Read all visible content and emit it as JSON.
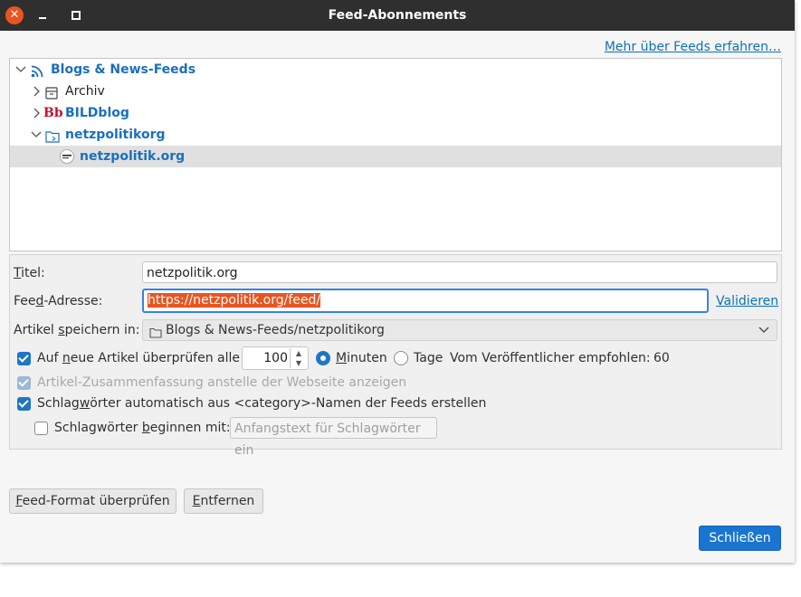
{
  "window": {
    "title": "Feed-Abonnements",
    "close_glyph": "✕"
  },
  "learn_more": "Mehr über Feeds erfahren…",
  "tree": {
    "items": [
      {
        "label": "Blogs & News-Feeds",
        "icon": "rss-icon",
        "toggle": "⌵"
      },
      {
        "label": "Archiv",
        "icon": "archive-icon",
        "toggle": "›"
      },
      {
        "label": "BILDblog",
        "icon": "bildblog-icon",
        "toggle": "›",
        "icon_text": "Bb"
      },
      {
        "label": "netzpolitikorg",
        "icon": "folder-rss-icon",
        "toggle": "⌵"
      },
      {
        "label": "netzpolitik.org",
        "icon": "favicon-icon"
      }
    ]
  },
  "form": {
    "title_label": "Titel:",
    "title_label_u": "T",
    "title_label_rest": "itel:",
    "title_value": "netzpolitik.org",
    "url_label_a": "Fee",
    "url_label_u": "d",
    "url_label_b": "-Adresse:",
    "url_value": "https://netzpolitik.org/feed/",
    "validate": "Validieren",
    "store_label_a": "Artikel ",
    "store_label_u": "s",
    "store_label_b": "peichern in:",
    "store_value": "Blogs & News-Feeds/netzpolitikorg",
    "check_label_a": "Auf ",
    "check_label_u": "n",
    "check_label_b": "eue Artikel überprüfen alle",
    "interval": "100",
    "minutes_u": "M",
    "minutes_rest": "inuten",
    "days": "Tage",
    "publisher": "Vom Veröffentlicher empfohlen:",
    "publisher_value": "60",
    "summary_label": "Artikel-Zusammenfassung anstelle der Webseite anzeigen",
    "tags_a": "Schlag",
    "tags_u": "w",
    "tags_b": "örter automatisch aus <category>-Namen der Feeds erstellen",
    "prefix_a": "Schlagwörter ",
    "prefix_u": "b",
    "prefix_b": "eginnen mit:",
    "prefix_placeholder": "Anfangstext für Schlagwörter ein"
  },
  "buttons": {
    "verify_u": "F",
    "verify_rest": "eed-Format überprüfen",
    "remove_u": "E",
    "remove_rest": "ntfernen",
    "close": "Schließen"
  },
  "colors": {
    "accent": "#1a74d1",
    "selection": "#e95420",
    "folder_text": "#1a6fbf",
    "titlebar": "#2f2f2f"
  }
}
